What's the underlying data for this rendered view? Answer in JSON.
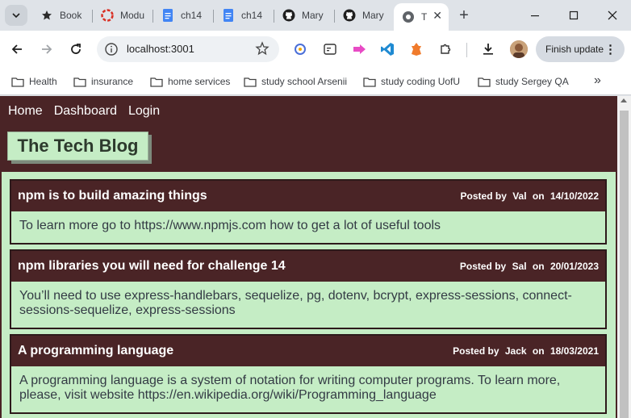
{
  "browser": {
    "tabs": [
      {
        "label": "Book",
        "icon": "star-icon"
      },
      {
        "label": "Modu",
        "icon": "module-icon"
      },
      {
        "label": "ch14",
        "icon": "docs-icon"
      },
      {
        "label": "ch14",
        "icon": "docs-icon"
      },
      {
        "label": "Mary",
        "icon": "github-icon"
      },
      {
        "label": "Mary",
        "icon": "github-icon"
      },
      {
        "label": "T",
        "icon": "globe-icon",
        "active": true
      }
    ],
    "address": "localhost:3001",
    "update_button": "Finish update",
    "bookmarks": [
      "Health",
      "insurance",
      "home services",
      "study school Arsenii",
      "study coding UofU",
      "study Sergey QA"
    ]
  },
  "site": {
    "nav": {
      "home": "Home",
      "dashboard": "Dashboard",
      "login": "Login"
    },
    "brand": "The Tech Blog",
    "posts": [
      {
        "title": "npm is to build amazing things",
        "posted_by_label": "Posted by",
        "author": "Val",
        "on_label": "on",
        "date": "14/10/2022",
        "body": "To learn more go to https://www.npmjs.com how to get a lot of useful tools"
      },
      {
        "title": "npm libraries you will need for challenge 14",
        "posted_by_label": "Posted by",
        "author": "Sal",
        "on_label": "on",
        "date": "20/01/2023",
        "body": "You’ll need to use express-handlebars, sequelize, pg, dotenv, bcrypt, express-sessions, connect-sessions-sequelize, express-sessions"
      },
      {
        "title": "A programming language",
        "posted_by_label": "Posted by",
        "author": "Jack",
        "on_label": "on",
        "date": "18/03/2021",
        "body": "A programming language is a system of notation for writing computer programs. To learn more, please, visit website https://en.wikipedia.org/wiki/Programming_language"
      }
    ]
  },
  "colors": {
    "header_bg": "#4a2426",
    "content_bg": "#c5edc5",
    "accent_text": "#ffffff"
  }
}
